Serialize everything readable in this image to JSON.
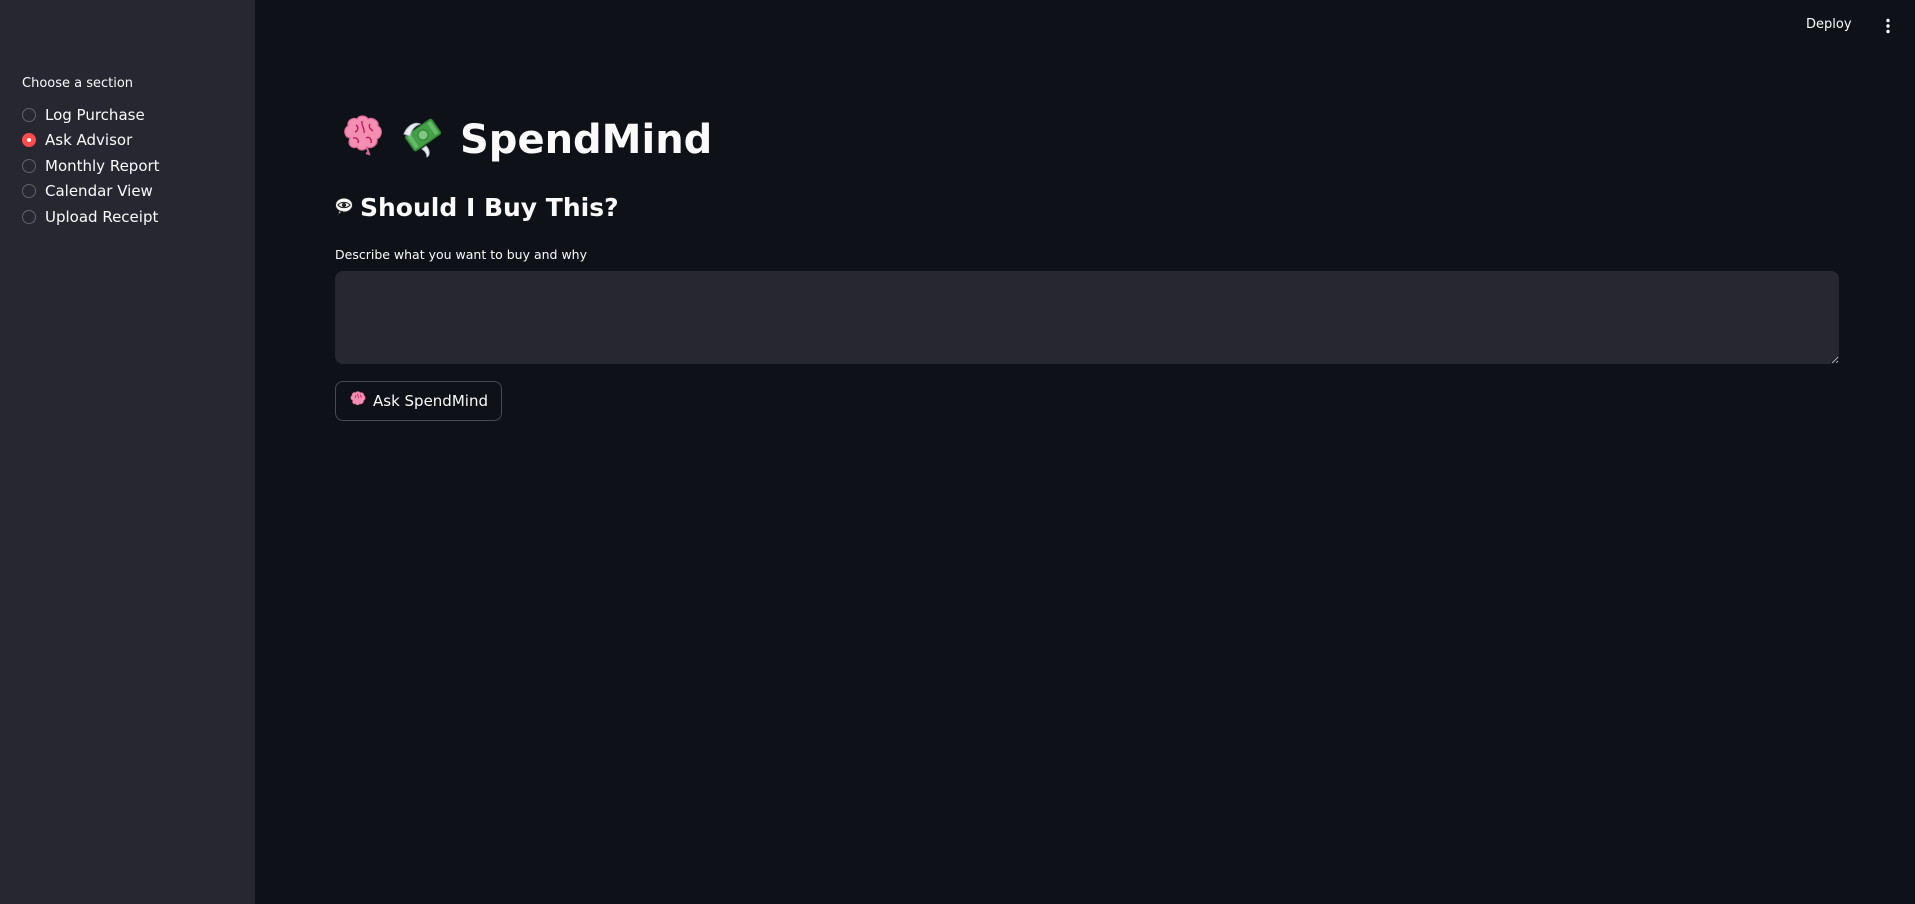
{
  "header": {
    "deploy_label": "Deploy",
    "menu_icon": "vertical-ellipsis-icon"
  },
  "sidebar": {
    "group_label": "Choose a section",
    "options": [
      {
        "label": "Log Purchase",
        "selected": false
      },
      {
        "label": "Ask Advisor",
        "selected": true
      },
      {
        "label": "Monthly Report",
        "selected": false
      },
      {
        "label": "Calendar View",
        "selected": false
      },
      {
        "label": "Upload Receipt",
        "selected": false
      }
    ],
    "accent_color": "#ff4b4b"
  },
  "main": {
    "title": "SpendMind",
    "title_icons": [
      "brain-icon",
      "money-with-wings-icon"
    ],
    "subheader": "Should I Buy This?",
    "subheader_icon": "eye-in-speech-bubble-icon",
    "input_label": "Describe what you want to buy and why",
    "input_value": "",
    "button_label": "Ask SpendMind",
    "button_icon": "brain-icon"
  },
  "colors": {
    "background": "#0e1117",
    "sidebar": "#262730",
    "text": "#fafafa"
  }
}
